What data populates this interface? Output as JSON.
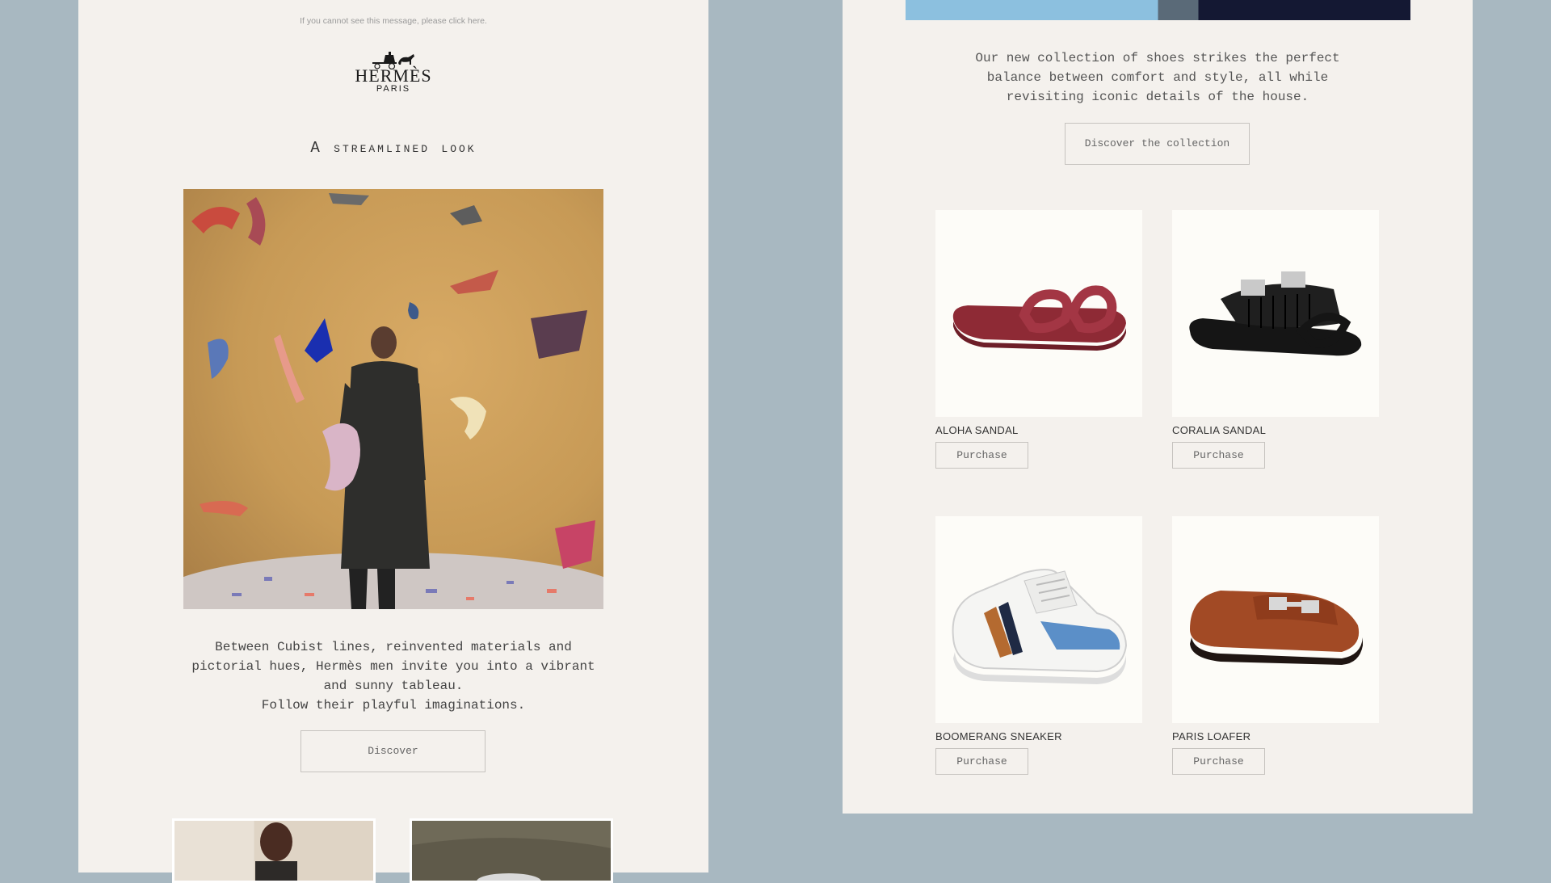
{
  "left": {
    "preheader": "If you cannot see this message, please click here.",
    "logo": {
      "brand": "HERMÈS",
      "city": "PARIS"
    },
    "headline": "A streamlined look",
    "body_lines": [
      "Between Cubist lines, reinvented materials and",
      "pictorial hues, Hermès men invite you into a vibrant",
      "and sunny tableau.",
      "Follow their playful imaginations."
    ],
    "discover_label": "Discover"
  },
  "right": {
    "intro_lines": [
      "Our new collection of shoes strikes the perfect",
      "balance between comfort and style, all while",
      "revisiting iconic details of the house."
    ],
    "collection_label": "Discover the collection",
    "products": [
      {
        "name": "ALOHA SANDAL",
        "action": "Purchase"
      },
      {
        "name": "CORALIA SANDAL",
        "action": "Purchase"
      },
      {
        "name": "BOOMERANG SNEAKER",
        "action": "Purchase"
      },
      {
        "name": "PARIS LOAFER",
        "action": "Purchase"
      }
    ]
  },
  "colors": {
    "page_bg": "#a8b8c1",
    "column_bg": "#f4f1ed",
    "text": "#444444"
  }
}
